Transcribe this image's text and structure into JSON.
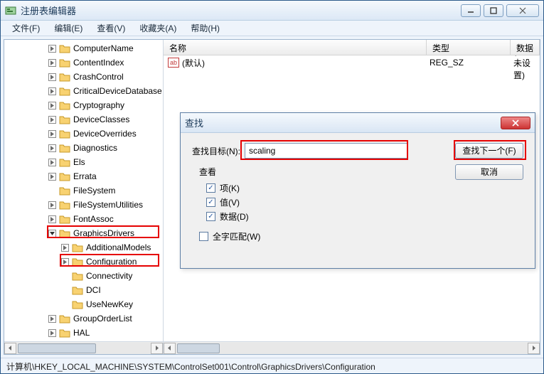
{
  "window": {
    "title": "注册表编辑器"
  },
  "menu": {
    "file": "文件(F)",
    "edit": "编辑(E)",
    "view": "查看(V)",
    "favorites": "收藏夹(A)",
    "help": "帮助(H)"
  },
  "tree": {
    "items": [
      {
        "indent": 62,
        "exp": ">",
        "label": "ComputerName"
      },
      {
        "indent": 62,
        "exp": ">",
        "label": "ContentIndex"
      },
      {
        "indent": 62,
        "exp": ">",
        "label": "CrashControl"
      },
      {
        "indent": 62,
        "exp": ">",
        "label": "CriticalDeviceDatabase"
      },
      {
        "indent": 62,
        "exp": ">",
        "label": "Cryptography"
      },
      {
        "indent": 62,
        "exp": ">",
        "label": "DeviceClasses"
      },
      {
        "indent": 62,
        "exp": ">",
        "label": "DeviceOverrides"
      },
      {
        "indent": 62,
        "exp": ">",
        "label": "Diagnostics"
      },
      {
        "indent": 62,
        "exp": ">",
        "label": "Els"
      },
      {
        "indent": 62,
        "exp": ">",
        "label": "Errata"
      },
      {
        "indent": 62,
        "exp": " ",
        "label": "FileSystem"
      },
      {
        "indent": 62,
        "exp": ">",
        "label": "FileSystemUtilities"
      },
      {
        "indent": 62,
        "exp": ">",
        "label": "FontAssoc"
      },
      {
        "indent": 62,
        "exp": "v",
        "label": "GraphicsDrivers"
      },
      {
        "indent": 80,
        "exp": ">",
        "label": "AdditionalModels"
      },
      {
        "indent": 80,
        "exp": ">",
        "label": "Configuration"
      },
      {
        "indent": 80,
        "exp": " ",
        "label": "Connectivity"
      },
      {
        "indent": 80,
        "exp": " ",
        "label": "DCI"
      },
      {
        "indent": 80,
        "exp": " ",
        "label": "UseNewKey"
      },
      {
        "indent": 62,
        "exp": ">",
        "label": "GroupOrderList"
      },
      {
        "indent": 62,
        "exp": ">",
        "label": "HAL"
      }
    ]
  },
  "list": {
    "col_name": "名称",
    "col_type": "类型",
    "col_data": "数据",
    "row": {
      "name": "(默认)",
      "type": "REG_SZ",
      "data": "(数值未设置)"
    }
  },
  "dialog": {
    "title": "查找",
    "target_label": "查找目标(N):",
    "target_value": "scaling",
    "group_label": "查看",
    "opt_keys": "项(K)",
    "opt_values": "值(V)",
    "opt_data": "数据(D)",
    "whole_word": "全字匹配(W)",
    "find_next": "查找下一个(F)",
    "cancel": "取消"
  },
  "status": {
    "path": "计算机\\HKEY_LOCAL_MACHINE\\SYSTEM\\ControlSet001\\Control\\GraphicsDrivers\\Configuration"
  }
}
